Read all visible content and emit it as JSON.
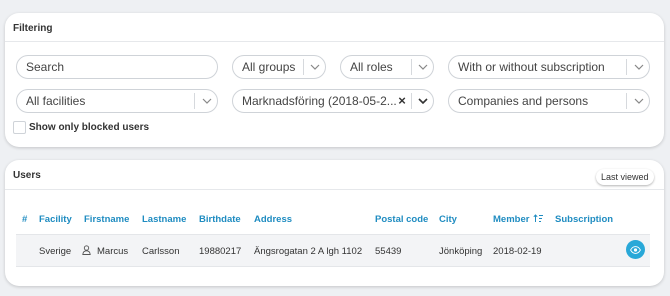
{
  "filtering": {
    "title": "Filtering",
    "search_placeholder": "Search",
    "groups_value": "All groups",
    "roles_value": "All roles",
    "subscription_value": "With or without subscription",
    "facilities_value": "All facilities",
    "campaign_value": "Marknadsföring (2018-05-2...",
    "type_value": "Companies and persons",
    "blocked_label": "Show only blocked users"
  },
  "users": {
    "title": "Users",
    "last_viewed_label": "Last viewed",
    "columns": [
      "#",
      "Facility",
      "Firstname",
      "Lastname",
      "Birthdate",
      "Address",
      "Postal code",
      "City",
      "Member",
      "Subscription"
    ],
    "rows": [
      {
        "facility": "Sverige",
        "firstname": "Marcus",
        "lastname": "Carlsson",
        "birthdate": "19880217",
        "address": "Ängsrogatan 2 A lgh 1102",
        "postal_code": "55439",
        "city": "Jönköping",
        "member": "2018-02-19",
        "subscription": ""
      }
    ]
  },
  "colors": {
    "accent": "#1f8cc1",
    "view_button": "#29a8d8",
    "background": "#eef0f3"
  }
}
